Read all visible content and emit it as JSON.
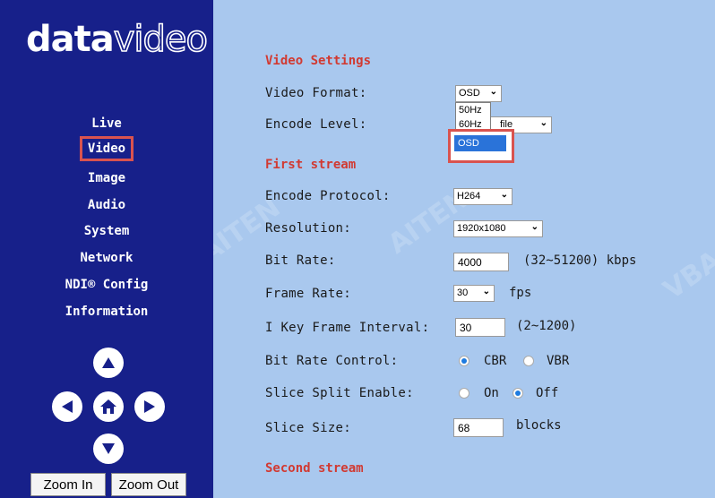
{
  "brand": {
    "logo_bold": "data",
    "logo_outline": "video"
  },
  "sidebar": {
    "nav": [
      {
        "label": "Live",
        "active": false
      },
      {
        "label": "Video",
        "active": true
      },
      {
        "label": "Image",
        "active": false
      },
      {
        "label": "Audio",
        "active": false
      },
      {
        "label": "System",
        "active": false
      },
      {
        "label": "Network",
        "active": false
      },
      {
        "label": "NDI® Config",
        "active": false
      },
      {
        "label": "Information",
        "active": false
      }
    ],
    "zoom_in": "Zoom In",
    "zoom_out": "Zoom Out"
  },
  "video_settings": {
    "title": "Video Settings",
    "video_format": {
      "label": "Video Format:",
      "value": "OSD",
      "options": [
        "50Hz",
        "60Hz",
        "OSD"
      ]
    },
    "encode_level": {
      "label": "Encode Level:",
      "value": "file"
    }
  },
  "first_stream": {
    "title": "First stream",
    "encode_protocol": {
      "label": "Encode Protocol:",
      "value": "H264"
    },
    "resolution": {
      "label": "Resolution:",
      "value": "1920x1080"
    },
    "bit_rate": {
      "label": "Bit Rate:",
      "value": "4000",
      "note": "(32~51200) kbps"
    },
    "frame_rate": {
      "label": "Frame Rate:",
      "value": "30",
      "unit": "fps"
    },
    "i_key_frame": {
      "label": "I Key Frame Interval:",
      "value": "30",
      "note": "(2~1200)"
    },
    "bit_rate_control": {
      "label": "Bit Rate Control:",
      "options": [
        "CBR",
        "VBR"
      ],
      "selected": "CBR"
    },
    "slice_split": {
      "label": "Slice Split Enable:",
      "options": [
        "On",
        "Off"
      ],
      "selected": "Off"
    },
    "slice_size": {
      "label": "Slice Size:",
      "value": "68",
      "unit": "blocks"
    }
  },
  "second_stream": {
    "title": "Second stream"
  },
  "colors": {
    "sidebar": "#17208a",
    "main": "#a9c8ee",
    "highlight": "#d9534f",
    "section": "#d13a32"
  }
}
